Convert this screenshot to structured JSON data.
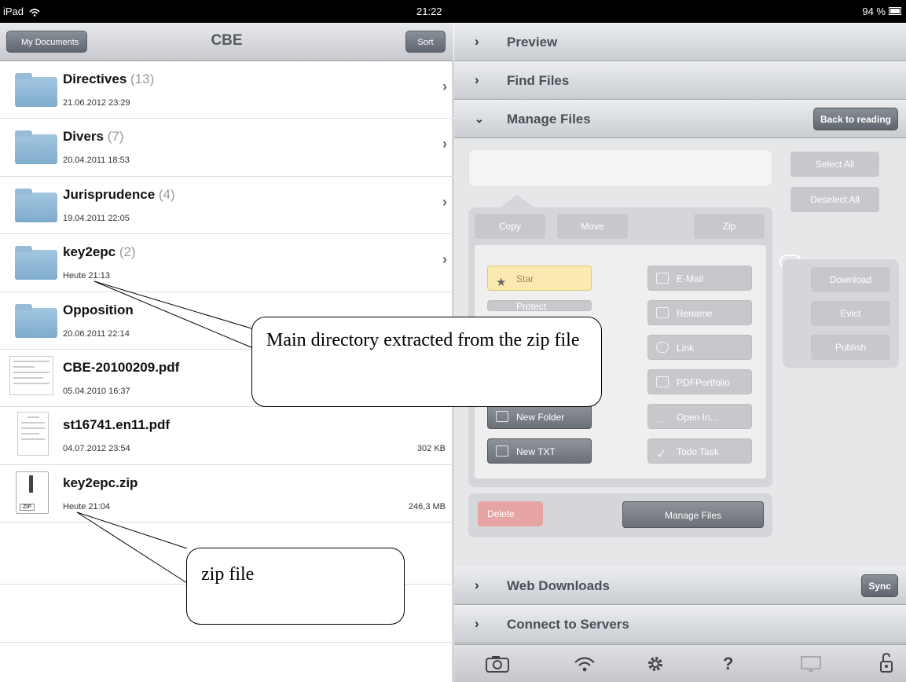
{
  "status": {
    "device": "iPad",
    "time": "21:22",
    "battery": "94 %"
  },
  "nav": {
    "back_label": "My Documents",
    "title": "CBE",
    "sort_label": "Sort"
  },
  "files": [
    {
      "name": "Directives",
      "count": "(13)",
      "date": "21.06.2012 23:29",
      "size": "",
      "type": "folder"
    },
    {
      "name": "Divers",
      "count": "(7)",
      "date": "20.04.2011 18:53",
      "size": "",
      "type": "folder"
    },
    {
      "name": "Jurisprudence",
      "count": "(4)",
      "date": "19.04.2011 22:05",
      "size": "",
      "type": "folder"
    },
    {
      "name": "key2epc",
      "count": "(2)",
      "date": "Heute 21:13",
      "size": "",
      "type": "folder"
    },
    {
      "name": "Opposition",
      "count": "",
      "date": "20.06.2011 22:14",
      "size": "",
      "type": "folder"
    },
    {
      "name": "CBE-20100209.pdf",
      "count": "",
      "date": "05.04.2010 16:37",
      "size": "",
      "type": "pdf"
    },
    {
      "name": "st16741.en11.pdf",
      "count": "",
      "date": "04.07.2012 23:54",
      "size": "302 KB",
      "type": "pdf"
    },
    {
      "name": "key2epc.zip",
      "count": "",
      "date": "Heute 21:04",
      "size": "246,3 MB",
      "type": "zip",
      "icon_label": "ZIP"
    }
  ],
  "sections": {
    "preview": "Preview",
    "find_files": "Find Files",
    "manage_files": "Manage Files",
    "back_to_reading": "Back to reading",
    "web_downloads": "Web Downloads",
    "sync": "Sync",
    "connect_servers": "Connect to Servers"
  },
  "manage": {
    "select_all": "Select All",
    "deselect_all": "Deselect All",
    "copy": "Copy",
    "move": "Move",
    "zip": "Zip",
    "star": "Star",
    "protect": "Protect",
    "email": "E-Mail",
    "rename": "Rename",
    "link": "Link",
    "pdfportfolio": "PDFPortfolio",
    "new_folder": "New Folder",
    "open_in": "Open In...",
    "new_txt": "New TXT",
    "todo_task": "Todo Task",
    "download": "Download",
    "evict": "Evict",
    "publish": "Publish",
    "delete": "Delete",
    "manage_files_btn": "Manage Files"
  },
  "toolbar": {
    "icons": [
      "camera-icon",
      "wifi-icon",
      "gear-icon",
      "help-icon",
      "monitor-icon",
      "lock-icon"
    ],
    "help_glyph": "?"
  },
  "annotations": {
    "main_dir": "Main directory extracted from the zip file",
    "zip_file": "zip file"
  }
}
